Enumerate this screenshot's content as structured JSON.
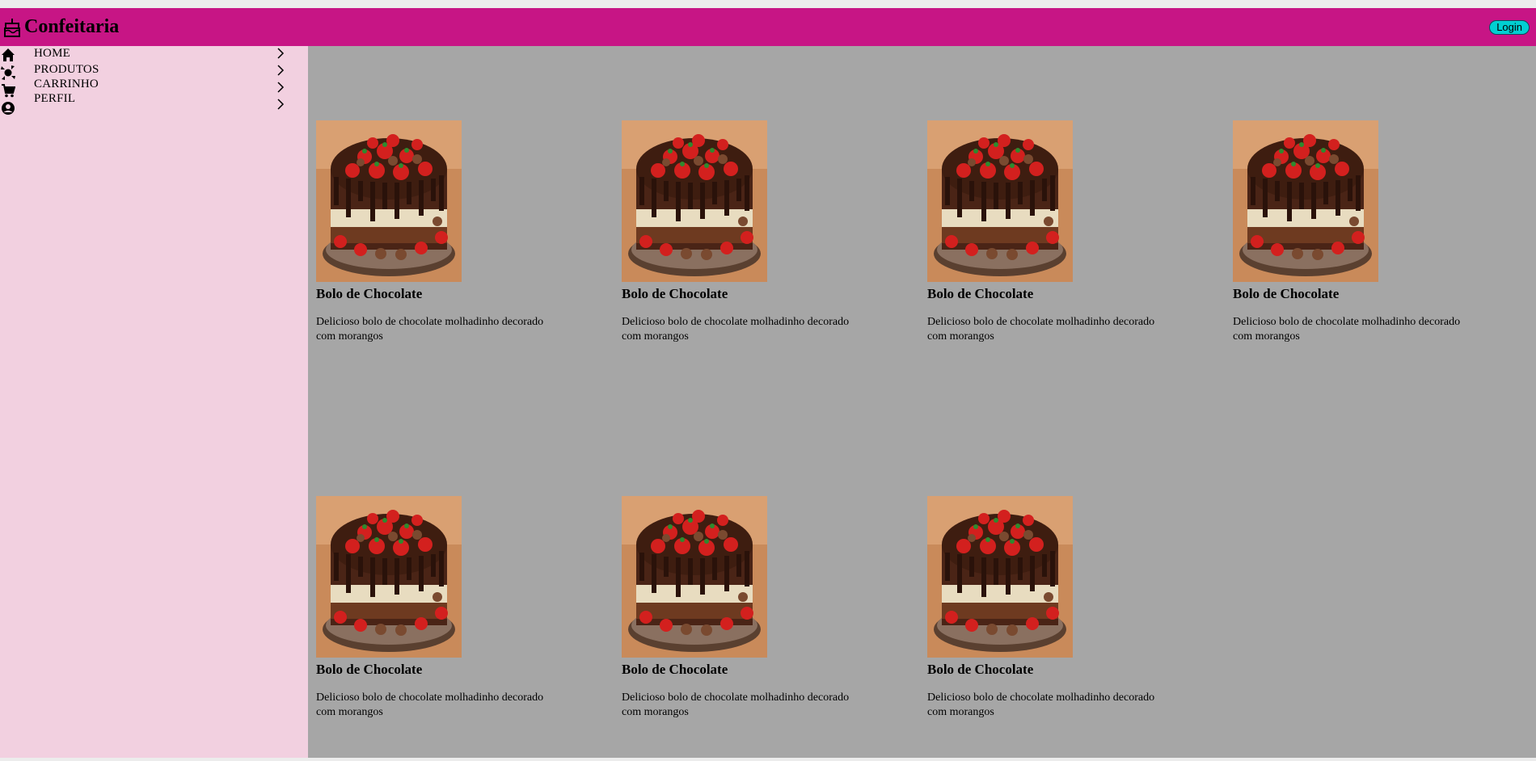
{
  "header": {
    "brand_title": "Confeitaria",
    "brand_icon": "cake-icon",
    "login_label": "Login",
    "accent_color": "#c71585",
    "login_color": "#00cfd2"
  },
  "sidebar": {
    "background": "#f2d0e0",
    "items": [
      {
        "label": "HOME",
        "icon": "home-icon"
      },
      {
        "label": "PRODUTOS",
        "icon": "candy-icon"
      },
      {
        "label": "CARRINHO",
        "icon": "cart-icon"
      },
      {
        "label": "PERFIL",
        "icon": "account-circle-icon"
      }
    ]
  },
  "products": [
    {
      "title": "Bolo de Chocolate",
      "description": "Delicioso bolo de chocolate molhadinho decorado com morangos"
    },
    {
      "title": "Bolo de Chocolate",
      "description": "Delicioso bolo de chocolate molhadinho decorado com morangos"
    },
    {
      "title": "Bolo de Chocolate",
      "description": "Delicioso bolo de chocolate molhadinho decorado com morangos"
    },
    {
      "title": "Bolo de Chocolate",
      "description": "Delicioso bolo de chocolate molhadinho decorado com morangos"
    },
    {
      "title": "Bolo de Chocolate",
      "description": "Delicioso bolo de chocolate molhadinho decorado com morangos"
    },
    {
      "title": "Bolo de Chocolate",
      "description": "Delicioso bolo de chocolate molhadinho decorado com morangos"
    },
    {
      "title": "Bolo de Chocolate",
      "description": "Delicioso bolo de chocolate molhadinho decorado com morangos"
    }
  ]
}
